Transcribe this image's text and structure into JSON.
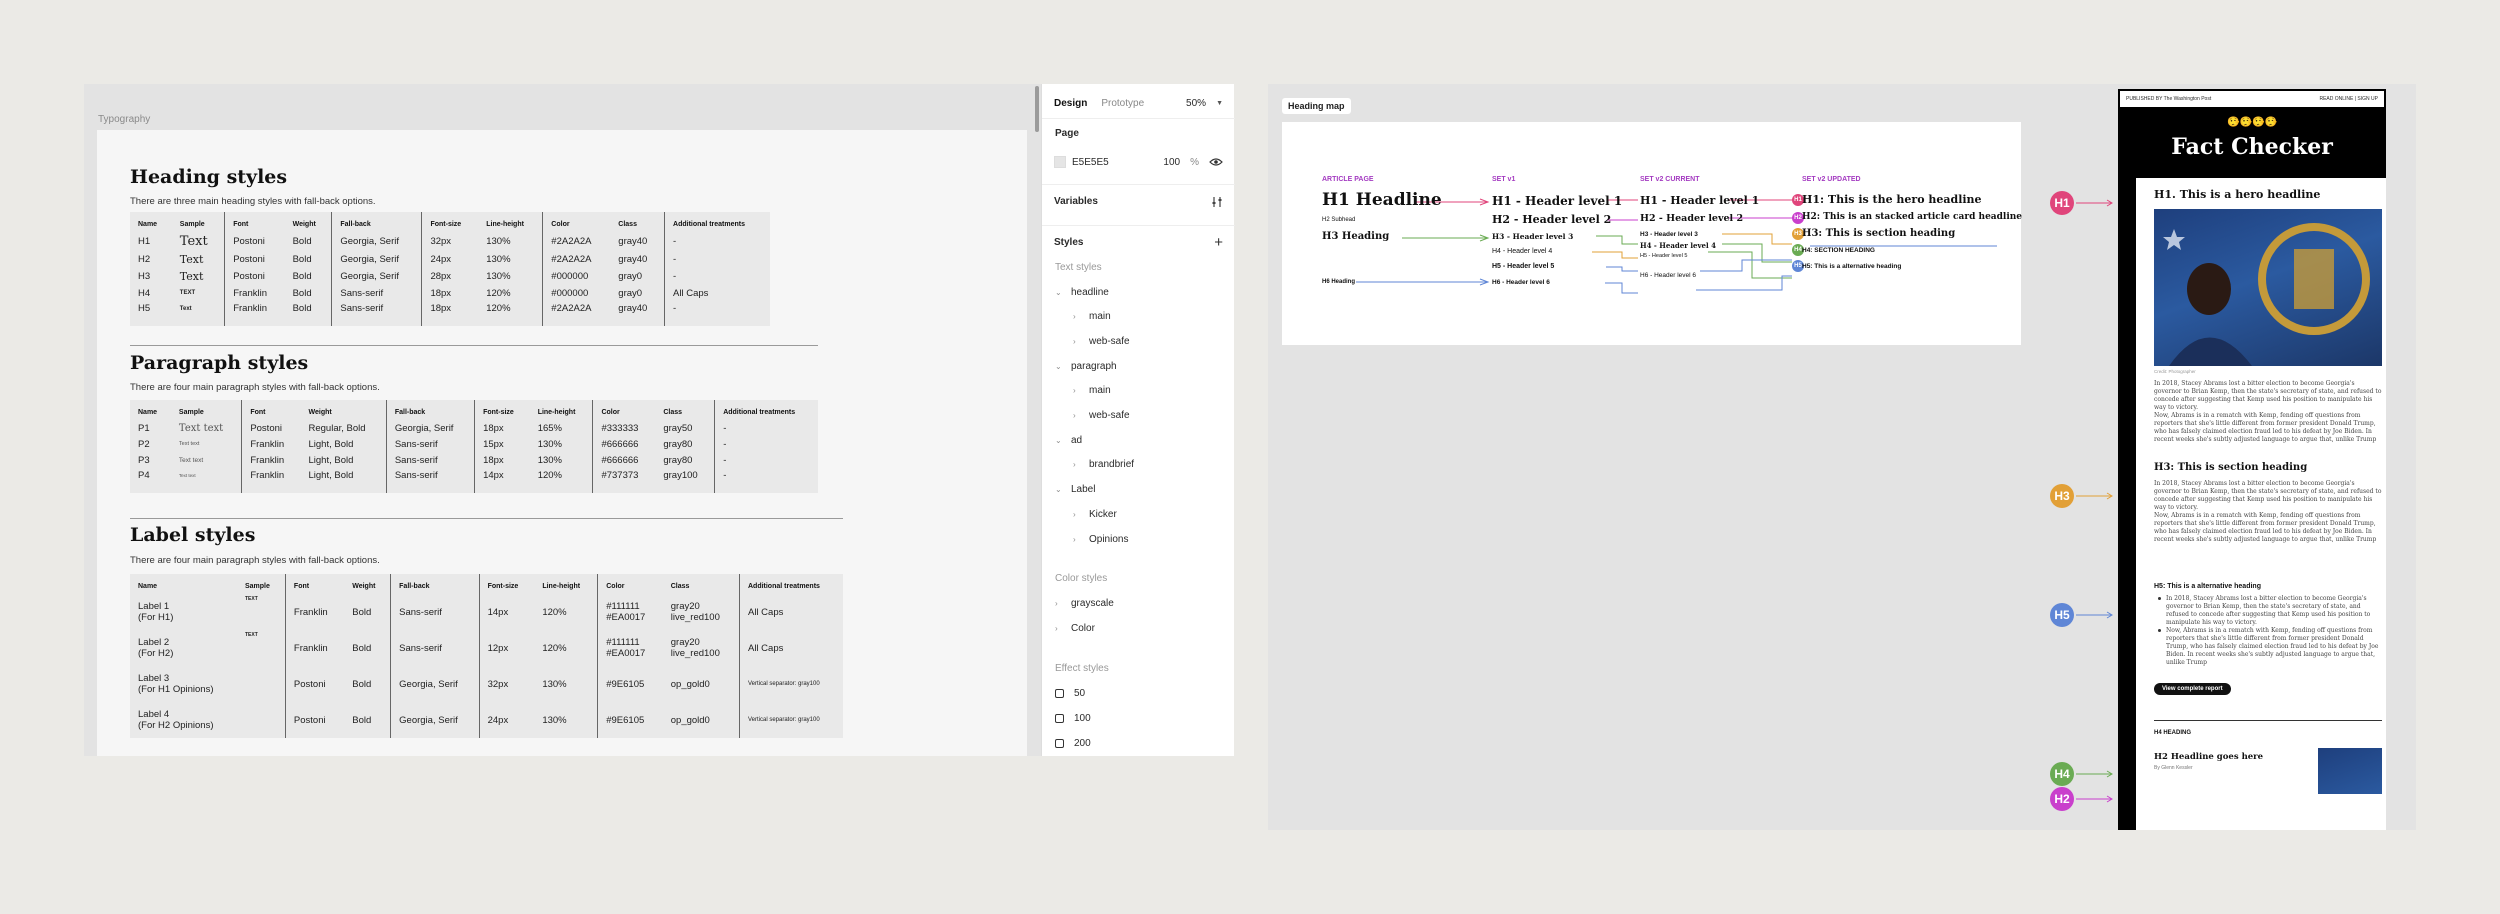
{
  "typography": {
    "frame_label": "Typography",
    "heading": {
      "title": "Heading styles",
      "desc": "There are three main heading styles with fall-back options.",
      "cols": [
        "Name",
        "Sample",
        "Font",
        "Weight",
        "Fall-back",
        "Font-size",
        "Line-height",
        "Color",
        "Class",
        "Additional treatments"
      ],
      "rows": [
        [
          "H1",
          "Text",
          "Postoni",
          "Bold",
          "Georgia, Serif",
          "32px",
          "130%",
          "#2A2A2A",
          "gray40",
          "-"
        ],
        [
          "H2",
          "Text",
          "Postoni",
          "Bold",
          "Georgia, Serif",
          "24px",
          "130%",
          "#2A2A2A",
          "gray40",
          "-"
        ],
        [
          "H3",
          "Text",
          "Postoni",
          "Bold",
          "Georgia, Serif",
          "28px",
          "130%",
          "#000000",
          "gray0",
          "-"
        ],
        [
          "H4",
          "TEXT",
          "Franklin",
          "Bold",
          "Sans-serif",
          "18px",
          "120%",
          "#000000",
          "gray0",
          "All Caps"
        ],
        [
          "H5",
          "Text",
          "Franklin",
          "Bold",
          "Sans-serif",
          "18px",
          "120%",
          "#2A2A2A",
          "gray40",
          "-"
        ]
      ]
    },
    "paragraph": {
      "title": "Paragraph styles",
      "desc": "There are four main paragraph styles with fall-back options.",
      "cols": [
        "Name",
        "Sample",
        "Font",
        "Weight",
        "Fall-back",
        "Font-size",
        "Line-height",
        "Color",
        "Class",
        "Additional treatments"
      ],
      "rows": [
        [
          "P1",
          "Text text",
          "Postoni",
          "Regular, Bold",
          "Georgia, Serif",
          "18px",
          "165%",
          "#333333",
          "gray50",
          "-"
        ],
        [
          "P2",
          "Text text",
          "Franklin",
          "Light, Bold",
          "Sans-serif",
          "15px",
          "130%",
          "#666666",
          "gray80",
          "-"
        ],
        [
          "P3",
          "Text text",
          "Franklin",
          "Light, Bold",
          "Sans-serif",
          "18px",
          "130%",
          "#666666",
          "gray80",
          "-"
        ],
        [
          "P4",
          "Text text",
          "Franklin",
          "Light, Bold",
          "Sans-serif",
          "14px",
          "120%",
          "#737373",
          "gray100",
          "-"
        ]
      ]
    },
    "label": {
      "title": "Label styles",
      "desc": "There are four main paragraph styles with fall-back options.",
      "cols": [
        "Name",
        "Sample",
        "Font",
        "Weight",
        "Fall-back",
        "Font-size",
        "Line-height",
        "Color",
        "Class",
        "Additional treatments"
      ],
      "rows": [
        {
          "name1": "Label 1",
          "name2": "(For H1)",
          "sample": "TEXT",
          "font": "Franklin",
          "weight": "Bold",
          "fallback": "Sans-serif",
          "size": "14px",
          "lh": "120%",
          "c1": "#111111",
          "c2": "#EA0017",
          "k1": "gray20",
          "k2": "live_red100",
          "add": "All Caps"
        },
        {
          "name1": "Label 2",
          "name2": "(For H2)",
          "sample": "TEXT",
          "font": "Franklin",
          "weight": "Bold",
          "fallback": "Sans-serif",
          "size": "12px",
          "lh": "120%",
          "c1": "#111111",
          "c2": "#EA0017",
          "k1": "gray20",
          "k2": "live_red100",
          "add": "All Caps"
        },
        {
          "name1": "Label 3",
          "name2": "(For H1 Opinions)",
          "sample": "",
          "font": "Postoni",
          "weight": "Bold",
          "fallback": "Georgia, Serif",
          "size": "32px",
          "lh": "130%",
          "c1": "#9E6105",
          "c2": "",
          "k1": "op_gold0",
          "k2": "",
          "add": "Vertical separator: gray100"
        },
        {
          "name1": "Label 4",
          "name2": "(For H2 Opinions)",
          "sample": "",
          "font": "Postoni",
          "weight": "Bold",
          "fallback": "Georgia, Serif",
          "size": "24px",
          "lh": "130%",
          "c1": "#9E6105",
          "c2": "",
          "k1": "op_gold0",
          "k2": "",
          "add": "Vertical separator: gray100"
        }
      ]
    }
  },
  "panel": {
    "tabs": [
      "Design",
      "Prototype"
    ],
    "zoom": "50%",
    "page_label": "Page",
    "page_color": "E5E5E5",
    "page_opacity": "100",
    "percent": "%",
    "variables": "Variables",
    "styles": "Styles",
    "text_styles": "Text styles",
    "tree": [
      {
        "label": "headline",
        "depth": 0,
        "open": true
      },
      {
        "label": "main",
        "depth": 1,
        "open": false
      },
      {
        "label": "web-safe",
        "depth": 1,
        "open": false
      },
      {
        "label": "paragraph",
        "depth": 0,
        "open": true
      },
      {
        "label": "main",
        "depth": 1,
        "open": false
      },
      {
        "label": "web-safe",
        "depth": 1,
        "open": false
      },
      {
        "label": "ad",
        "depth": 0,
        "open": true
      },
      {
        "label": "brandbrief",
        "depth": 1,
        "open": false
      },
      {
        "label": "Label",
        "depth": 0,
        "open": true
      },
      {
        "label": "Kicker",
        "depth": 1,
        "open": false
      },
      {
        "label": "Opinions",
        "depth": 1,
        "open": false
      }
    ],
    "color_styles": "Color styles",
    "colors": [
      "grayscale",
      "Color"
    ],
    "effect_styles": "Effect styles",
    "effects": [
      "50",
      "100",
      "200"
    ]
  },
  "map": {
    "tag": "Heading map",
    "cols": [
      "ARTICLE PAGE",
      "SET v1",
      "SET v2 CURRENT",
      "SET v2 UPDATED"
    ],
    "article": {
      "h1": "H1 Headline",
      "h2": "H2 Subhead",
      "h3": "H3 Heading",
      "h6": "H6 Heading"
    },
    "v1": [
      "H1 - Header level 1",
      "H2 - Header level 2",
      "H3 - Header level 3",
      "H4 - Header level 4",
      "H5 - Header level 5",
      "H6 - Header level 6"
    ],
    "v2": [
      "H1 - Header level 1",
      "H2 - Header level 2",
      "H3 - Header level 3",
      "H4 - Header level 4",
      "H5 - Header level 5",
      "H6 - Header level 6"
    ],
    "upd": [
      "H1: This is the hero headline",
      "H2: This is an stacked article card headline",
      "H3: This is section heading",
      "H4: SECTION HEADING",
      "H5: This is a alternative heading"
    ],
    "badges": [
      "H1",
      "H2",
      "H3",
      "H4",
      "H5"
    ]
  },
  "article": {
    "top_left": "PUBLISHED BY The Washington Post",
    "top_right": "READ ONLINE  |  SIGN UP",
    "pinocchios": "🤥🤥🤥🤥",
    "masthead": "Fact Checker",
    "h1": "H1. This is a hero headline",
    "caption": "Credit: Photographer",
    "p1": "In 2018, Stacey Abrams lost a bitter election to become Georgia's governor to Brian Kemp, then the state's secretary of state, and refused to concede after suggesting that Kemp used his position to manipulate his way to victory.",
    "p2": "Now, Abrams is in a rematch with Kemp, fending off questions from reporters that she's little different from former president Donald Trump, who has falsely claimed election fraud led to his defeat by Joe Biden. In recent weeks she's subtly adjusted language to argue that, unlike Trump",
    "h3": "H3: This is section heading",
    "h5": "H5: This is a alternative heading",
    "button": "View complete report",
    "h4": "H4 HEADING",
    "h2": "H2 Headline goes here",
    "byline": "By Glenn Kessler",
    "callouts": [
      "H1",
      "H3",
      "H5",
      "H4",
      "H2"
    ]
  },
  "colors": {
    "purple": "#a43bc1",
    "magenta": "#c93fcc",
    "pink": "#e0457b",
    "orange": "#e2a037",
    "green": "#6aab53",
    "blue": "#5f86d6"
  }
}
